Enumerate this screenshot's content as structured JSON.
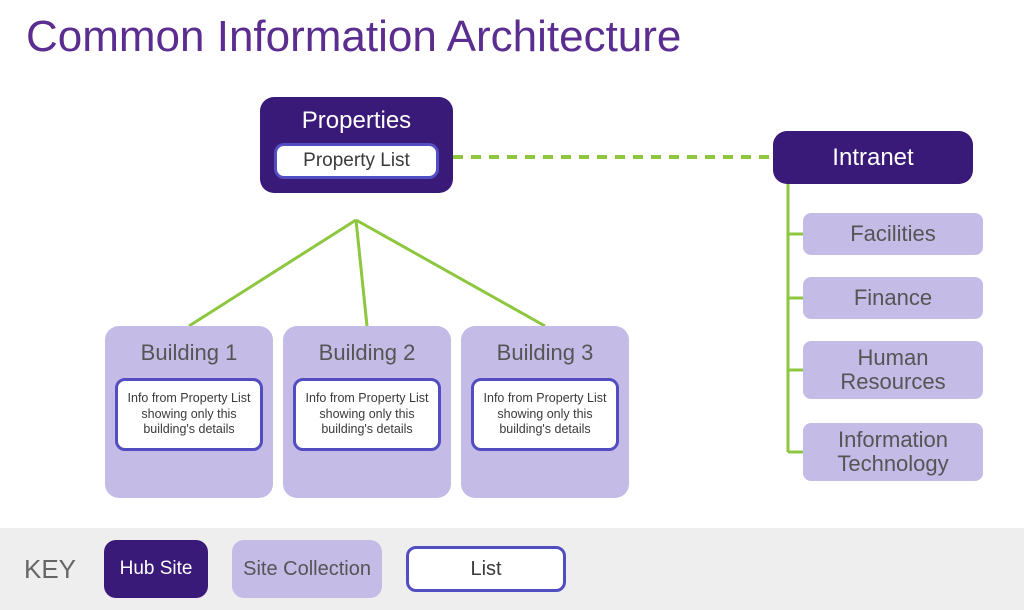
{
  "title": "Common Information Architecture",
  "hub": {
    "properties": {
      "label": "Properties",
      "list_label": "Property List"
    },
    "intranet": {
      "label": "Intranet"
    }
  },
  "buildings": [
    {
      "name": "Building 1",
      "info": "Info from Property List showing only this building's details"
    },
    {
      "name": "Building 2",
      "info": "Info from Property List showing only this building's details"
    },
    {
      "name": "Building 3",
      "info": "Info from Property List showing only this building's details"
    }
  ],
  "intranet_items": [
    "Facilities",
    "Finance",
    "Human Resources",
    "Information Technology"
  ],
  "key": {
    "label": "KEY",
    "hub": "Hub Site",
    "site": "Site Collection",
    "list": "List"
  },
  "colors": {
    "hub": "#3a1a78",
    "site": "#c4bbe6",
    "list_border": "#524dc0",
    "connector": "#8dc63f",
    "title": "#5b2d90"
  }
}
